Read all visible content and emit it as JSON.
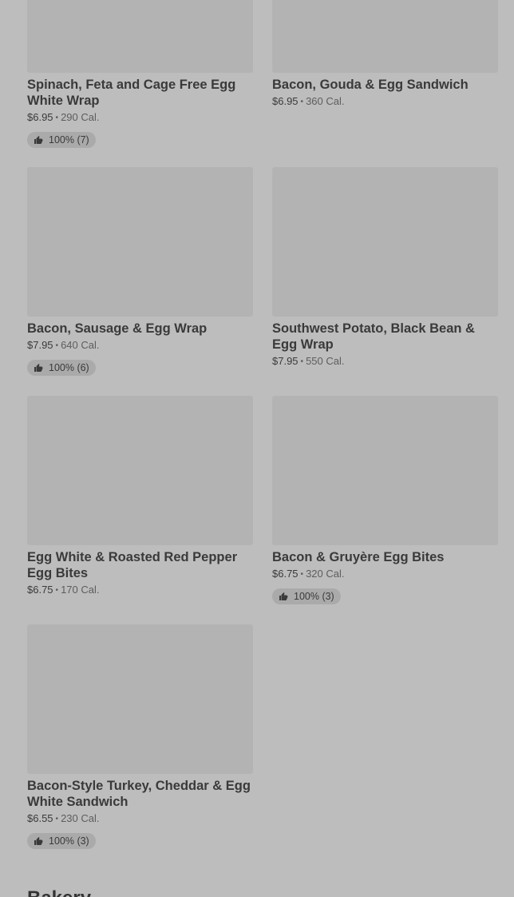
{
  "items": [
    {
      "name": "Spinach, Feta and Cage Free Egg White Wrap",
      "price": "$6.95",
      "calories": "290 Cal.",
      "rating": "100% (7)"
    },
    {
      "name": "Bacon, Gouda & Egg Sandwich",
      "price": "$6.95",
      "calories": "360 Cal.",
      "rating": ""
    },
    {
      "name": "Bacon, Sausage & Egg Wrap",
      "price": "$7.95",
      "calories": "640 Cal.",
      "rating": "100% (6)"
    },
    {
      "name": "Southwest Potato, Black Bean & Egg Wrap",
      "price": "$7.95",
      "calories": "550 Cal.",
      "rating": ""
    },
    {
      "name": "Egg White & Roasted Red Pepper Egg Bites",
      "price": "$6.75",
      "calories": "170 Cal.",
      "rating": ""
    },
    {
      "name": "Bacon & Gruyère Egg Bites",
      "price": "$6.75",
      "calories": "320 Cal.",
      "rating": "100% (3)"
    },
    {
      "name": "Bacon-Style Turkey, Cheddar & Egg White Sandwich",
      "price": "$6.55",
      "calories": "230 Cal.",
      "rating": "100% (3)"
    }
  ],
  "separator": "•",
  "next_section_title": "Bakery",
  "icons": {
    "rating": "thumbs-up-icon"
  }
}
